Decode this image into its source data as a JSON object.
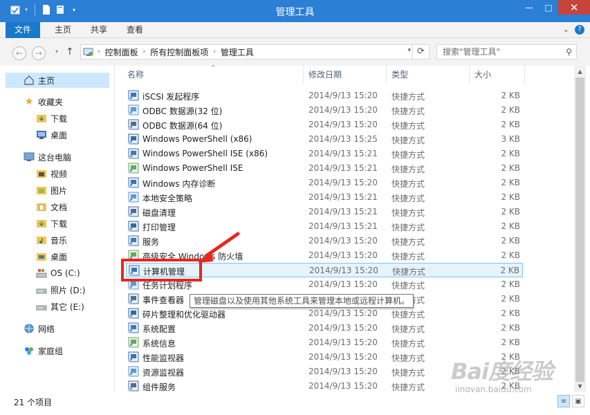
{
  "window": {
    "title": "管理工具"
  },
  "ribbon": {
    "tabs": [
      "文件",
      "主页",
      "共享",
      "查看"
    ]
  },
  "address": {
    "crumbs": [
      "控制面板",
      "所有控制面板项",
      "管理工具"
    ],
    "search_placeholder": "搜索\"管理工具\""
  },
  "nav": {
    "items": [
      {
        "label": "主页",
        "icon": "home-icon"
      },
      {
        "label": "收藏夹",
        "icon": "star-icon"
      },
      {
        "label": "下载",
        "icon": "download-folder-icon"
      },
      {
        "label": "桌面",
        "icon": "desktop-icon"
      },
      {
        "label": "这台电脑",
        "icon": "computer-icon"
      },
      {
        "label": "视频",
        "icon": "video-folder-icon"
      },
      {
        "label": "图片",
        "icon": "pictures-folder-icon"
      },
      {
        "label": "文档",
        "icon": "documents-folder-icon"
      },
      {
        "label": "下载",
        "icon": "download-folder-icon"
      },
      {
        "label": "音乐",
        "icon": "music-folder-icon"
      },
      {
        "label": "桌面",
        "icon": "desktop-folder-icon"
      },
      {
        "label": "OS (C:)",
        "icon": "system-drive-icon"
      },
      {
        "label": "照片 (D:)",
        "icon": "drive-icon"
      },
      {
        "label": "其它 (E:)",
        "icon": "drive-icon"
      },
      {
        "label": "网络",
        "icon": "network-icon"
      },
      {
        "label": "家庭组",
        "icon": "homegroup-icon"
      }
    ]
  },
  "columns": {
    "name": "名称",
    "date": "修改日期",
    "type": "类型",
    "size": "大小"
  },
  "files": [
    {
      "name": "iSCSI 发起程序",
      "date": "2014/9/13 15:20",
      "type": "快捷方式",
      "size": "2 KB"
    },
    {
      "name": "ODBC 数据源(32 位)",
      "date": "2014/9/13 15:20",
      "type": "快捷方式",
      "size": "2 KB"
    },
    {
      "name": "ODBC 数据源(64 位)",
      "date": "2014/9/13 15:20",
      "type": "快捷方式",
      "size": "2 KB"
    },
    {
      "name": "Windows PowerShell (x86)",
      "date": "2014/9/13 15:25",
      "type": "快捷方式",
      "size": "3 KB"
    },
    {
      "name": "Windows PowerShell ISE (x86)",
      "date": "2014/9/13 15:21",
      "type": "快捷方式",
      "size": "2 KB"
    },
    {
      "name": "Windows PowerShell ISE",
      "date": "2014/9/13 15:21",
      "type": "快捷方式",
      "size": "2 KB"
    },
    {
      "name": "Windows 内存诊断",
      "date": "2014/9/13 15:20",
      "type": "快捷方式",
      "size": "2 KB"
    },
    {
      "name": "本地安全策略",
      "date": "2014/9/13 15:21",
      "type": "快捷方式",
      "size": "2 KB"
    },
    {
      "name": "磁盘清理",
      "date": "2014/9/13 15:21",
      "type": "快捷方式",
      "size": "2 KB"
    },
    {
      "name": "打印管理",
      "date": "2014/9/13 15:21",
      "type": "快捷方式",
      "size": "2 KB"
    },
    {
      "name": "服务",
      "date": "2014/9/13 15:20",
      "type": "快捷方式",
      "size": "2 KB"
    },
    {
      "name": "高级安全 Windows 防火墙",
      "date": "2014/9/13 15:20",
      "type": "快捷方式",
      "size": "2 KB"
    },
    {
      "name": "计算机管理",
      "date": "2014/9/13 15:20",
      "type": "快捷方式",
      "size": "2 KB"
    },
    {
      "name": "任务计划程序",
      "date": "2014/9/13 15:20",
      "type": "快捷方式",
      "size": "2 KB"
    },
    {
      "name": "事件查看器",
      "date": "2014/9/13 15:20",
      "type": "快捷方式",
      "size": "2 KB"
    },
    {
      "name": "碎片整理和优化驱动器",
      "date": "2014/9/13 15:20",
      "type": "快捷方式",
      "size": "2 KB"
    },
    {
      "name": "系统配置",
      "date": "2014/9/13 15:20",
      "type": "快捷方式",
      "size": "2 KB"
    },
    {
      "name": "系统信息",
      "date": "2014/9/13 15:20",
      "type": "快捷方式",
      "size": "2 KB"
    },
    {
      "name": "性能监视器",
      "date": "2014/9/13 15:20",
      "type": "快捷方式",
      "size": "2 KB"
    },
    {
      "name": "资源监视器",
      "date": "2014/9/13 15:20",
      "type": "快捷方式",
      "size": "2 KB"
    },
    {
      "name": "组件服务",
      "date": "2014/9/13 15:20",
      "type": "快捷方式",
      "size": "2 KB"
    }
  ],
  "tooltip": "管理磁盘以及使用其他系统工具来管理本地或远程计算机。",
  "status": {
    "count": "21 个项目"
  },
  "watermark": {
    "logo": "Bai度经验",
    "url": "jingyan.baidu.com"
  },
  "colors": {
    "accent": "#2b7fd4",
    "file_tab": "#1979ca",
    "highlight": "#e8261f",
    "selection": "#e5f3fb"
  }
}
